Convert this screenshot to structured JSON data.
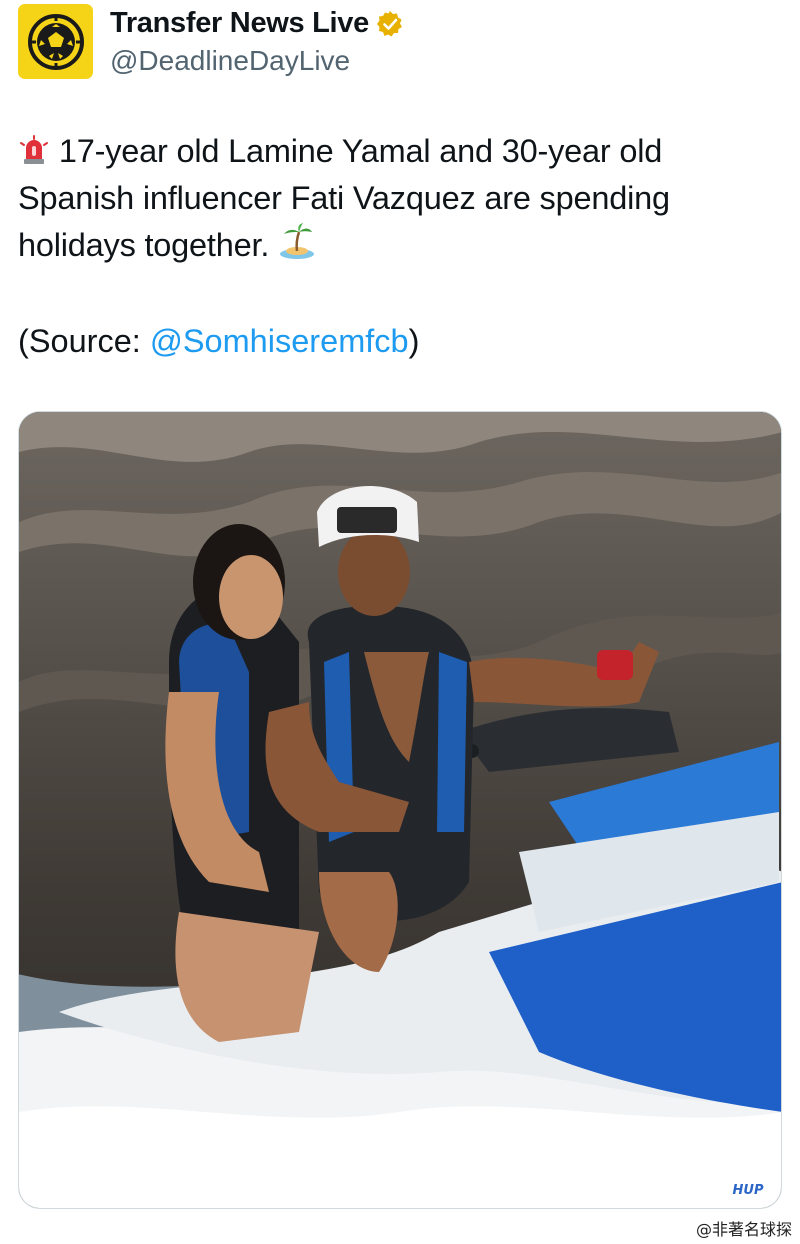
{
  "account": {
    "display_name": "Transfer News Live",
    "handle": "@DeadlineDayLive",
    "avatar_icon": "soccer-ball-icon",
    "verified_icon": "verified-badge-icon",
    "avatar_color": "#f5d417",
    "badge_color": "#e8b100"
  },
  "tweet": {
    "alert_icon": "siren-icon",
    "line1": "17-year old Lamine Yamal and 30-year old",
    "line2": "Spanish influencer Fati Vazquez are spending",
    "line3": "holidays together.",
    "island_icon": "desert-island-icon",
    "source_prefix": "(Source: ",
    "source_mention": "@Somhiseremfcb",
    "source_suffix": ")",
    "mention_color": "#1d9bf0"
  },
  "media": {
    "image_alt": "photo",
    "badge_text": "HUP"
  },
  "watermark": "@非著名球探"
}
